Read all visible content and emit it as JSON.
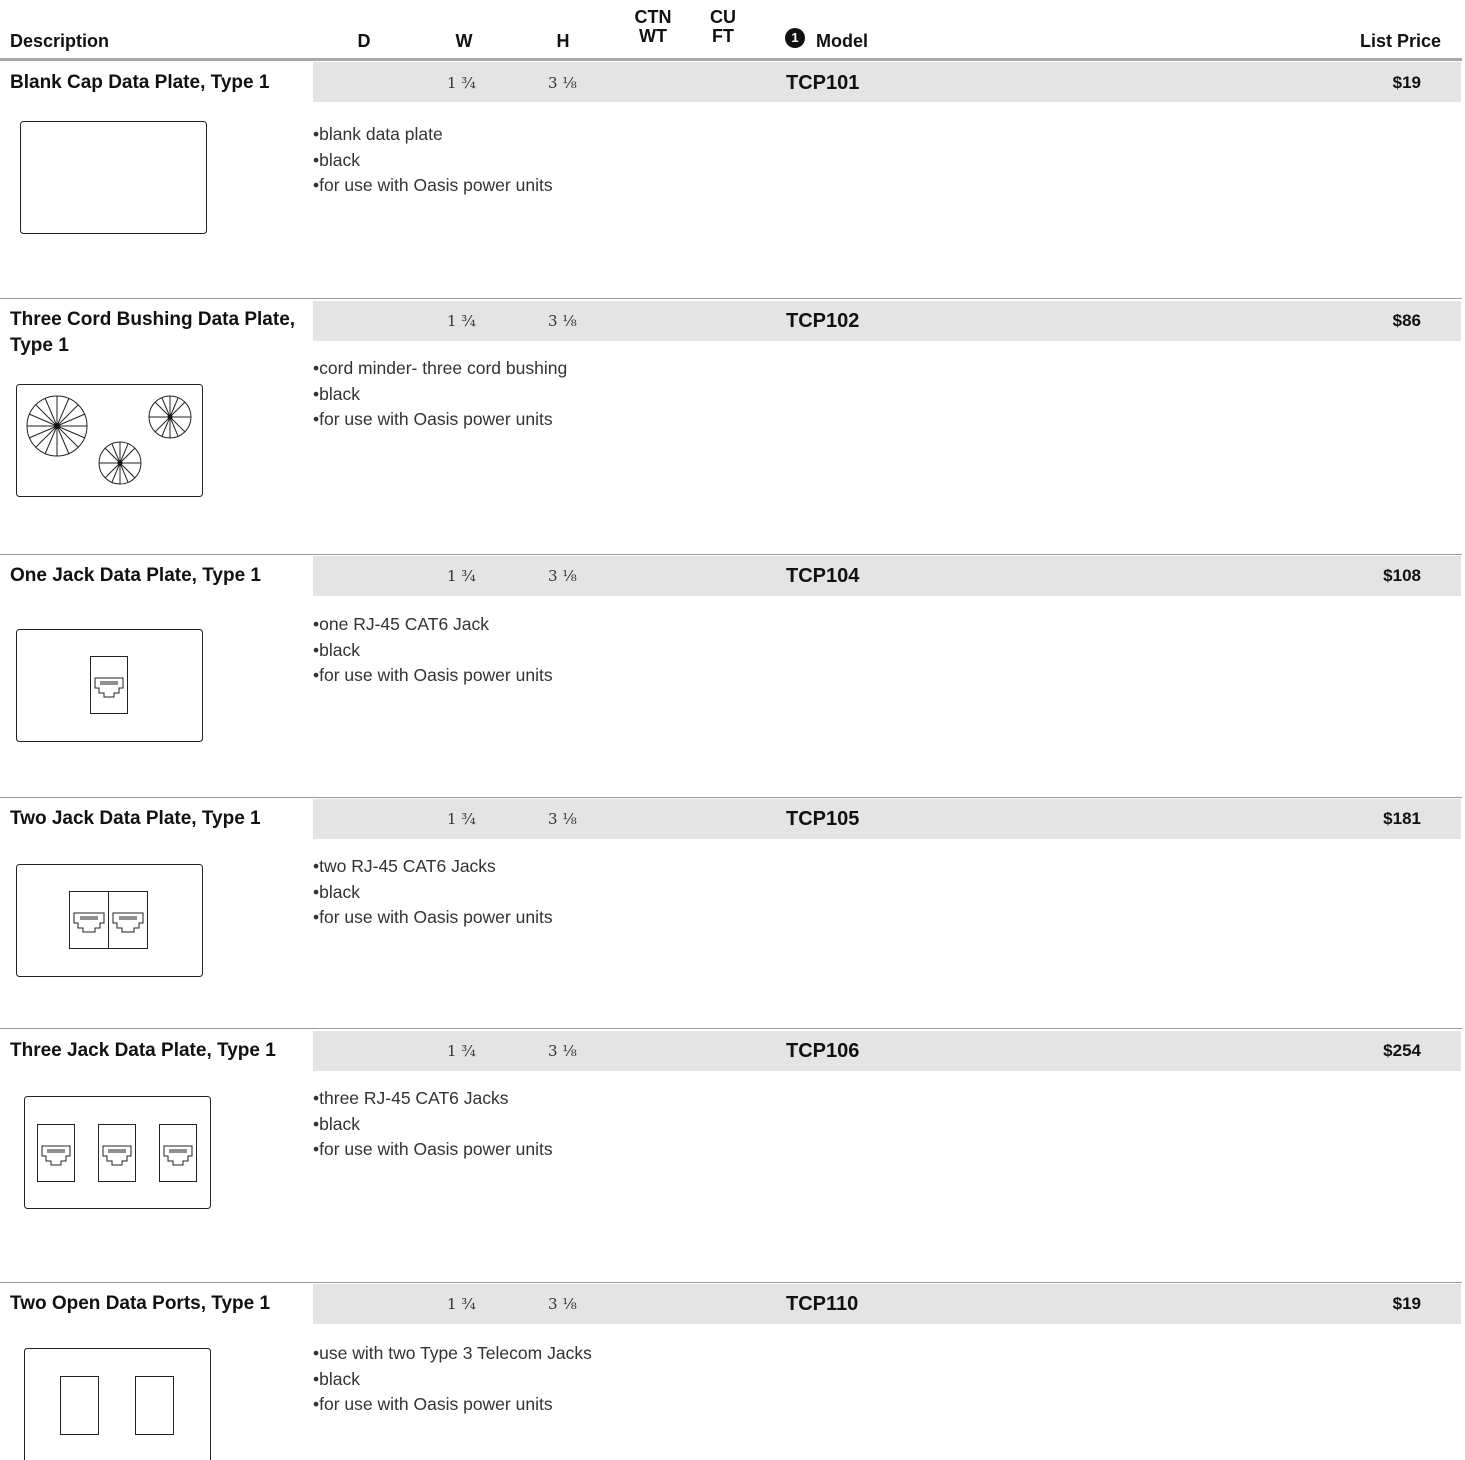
{
  "header": {
    "description": "Description",
    "d": "D",
    "w": "W",
    "h": "H",
    "ctn_wt_top": "CTN",
    "ctn_wt_bottom": "WT",
    "cu_ft_top": "CU",
    "cu_ft_bottom": "FT",
    "note_number": "1",
    "model": "Model",
    "list_price": "List Price"
  },
  "rows": [
    {
      "title": "Blank Cap Data Plate, Type 1",
      "w": "1 ¾",
      "h": "3 ⅛",
      "model": "TCP101",
      "price": "$19",
      "bullets": [
        "blank data plate",
        "black",
        "for use with Oasis power units"
      ]
    },
    {
      "title": "Three Cord Bushing Data Plate, Type 1",
      "w": "1 ¾",
      "h": "3 ⅛",
      "model": "TCP102",
      "price": "$86",
      "bullets": [
        "cord minder- three cord bushing",
        "black",
        "for use with Oasis power units"
      ]
    },
    {
      "title": "One Jack Data Plate, Type 1",
      "w": "1 ¾",
      "h": "3 ⅛",
      "model": "TCP104",
      "price": "$108",
      "bullets": [
        "one RJ-45 CAT6 Jack",
        "black",
        "for use with Oasis power units"
      ]
    },
    {
      "title": "Two Jack Data Plate, Type 1",
      "w": "1 ¾",
      "h": "3 ⅛",
      "model": "TCP105",
      "price": "$181",
      "bullets": [
        "two RJ-45 CAT6 Jacks",
        "black",
        "for use with Oasis power units"
      ]
    },
    {
      "title": "Three Jack Data Plate, Type 1",
      "w": "1 ¾",
      "h": "3 ⅛",
      "model": "TCP106",
      "price": "$254",
      "bullets": [
        "three RJ-45 CAT6 Jacks",
        "black",
        "for use with Oasis power units"
      ]
    },
    {
      "title": "Two Open Data Ports, Type 1",
      "w": "1 ¾",
      "h": "3 ⅛",
      "model": "TCP110",
      "price": "$19",
      "bullets": [
        "use with two Type 3 Telecom Jacks",
        "black",
        "for use with Oasis power units"
      ]
    }
  ]
}
